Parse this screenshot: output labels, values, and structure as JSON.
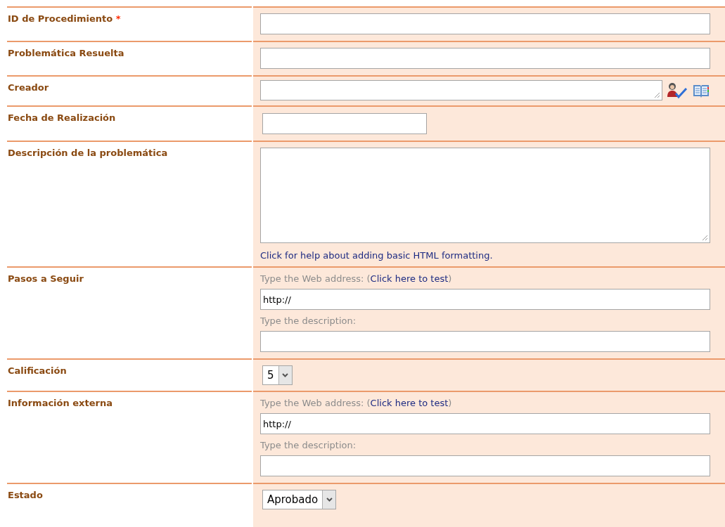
{
  "fields": [
    {
      "label": "ID de Procedimiento",
      "required_mark": "*",
      "kind": "text"
    },
    {
      "label": "Problemática Resuelta",
      "kind": "text"
    },
    {
      "label": "Creador",
      "kind": "people"
    },
    {
      "label": "Fecha de Realización",
      "kind": "date"
    },
    {
      "label": "Descripción de la problemática",
      "kind": "note",
      "help_link": "Click for help about adding basic HTML formatting."
    },
    {
      "label": "Pasos a Seguir",
      "kind": "url",
      "address_prompt_before": "Type the Web address: (",
      "test_link": "Click here to test",
      "address_prompt_after": ")",
      "address_value": "http://",
      "description_prompt": "Type the description:"
    },
    {
      "label": "Calificación",
      "kind": "choice",
      "value": "5"
    },
    {
      "label": "Información externa",
      "kind": "url",
      "address_prompt_before": "Type the Web address: (",
      "test_link": "Click here to test",
      "address_prompt_after": ")",
      "address_value": "http://",
      "description_prompt": "Type the description:"
    },
    {
      "label": "Estado",
      "kind": "choice",
      "value": "Aprobado"
    }
  ]
}
